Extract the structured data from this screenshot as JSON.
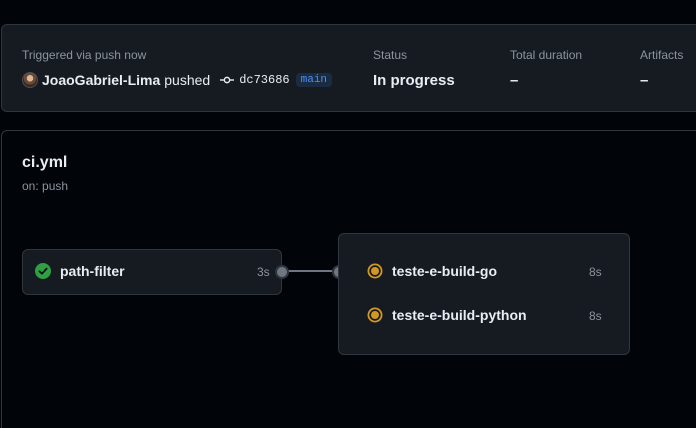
{
  "summary": {
    "trigger_label": "Triggered via push now",
    "actor": "JoaoGabriel-Lima",
    "action": "pushed",
    "commit_sha": "dc73686",
    "branch": "main",
    "status_label": "Status",
    "status_value": "In progress",
    "duration_label": "Total duration",
    "duration_value": "–",
    "artifacts_label": "Artifacts",
    "artifacts_value": "–"
  },
  "workflow": {
    "file": "ci.yml",
    "trigger": "on: push"
  },
  "jobs": [
    {
      "name": "path-filter",
      "duration": "3s",
      "status": "success"
    },
    {
      "name": "teste-e-build-go",
      "duration": "8s",
      "status": "in_progress"
    },
    {
      "name": "teste-e-build-python",
      "duration": "8s",
      "status": "in_progress"
    }
  ],
  "colors": {
    "success": "#2ea043",
    "in_progress": "#d29922",
    "link": "#4493f8"
  },
  "icons": {
    "success": "check-circle-icon",
    "in_progress": "in-progress-icon",
    "commit": "git-commit-icon"
  }
}
